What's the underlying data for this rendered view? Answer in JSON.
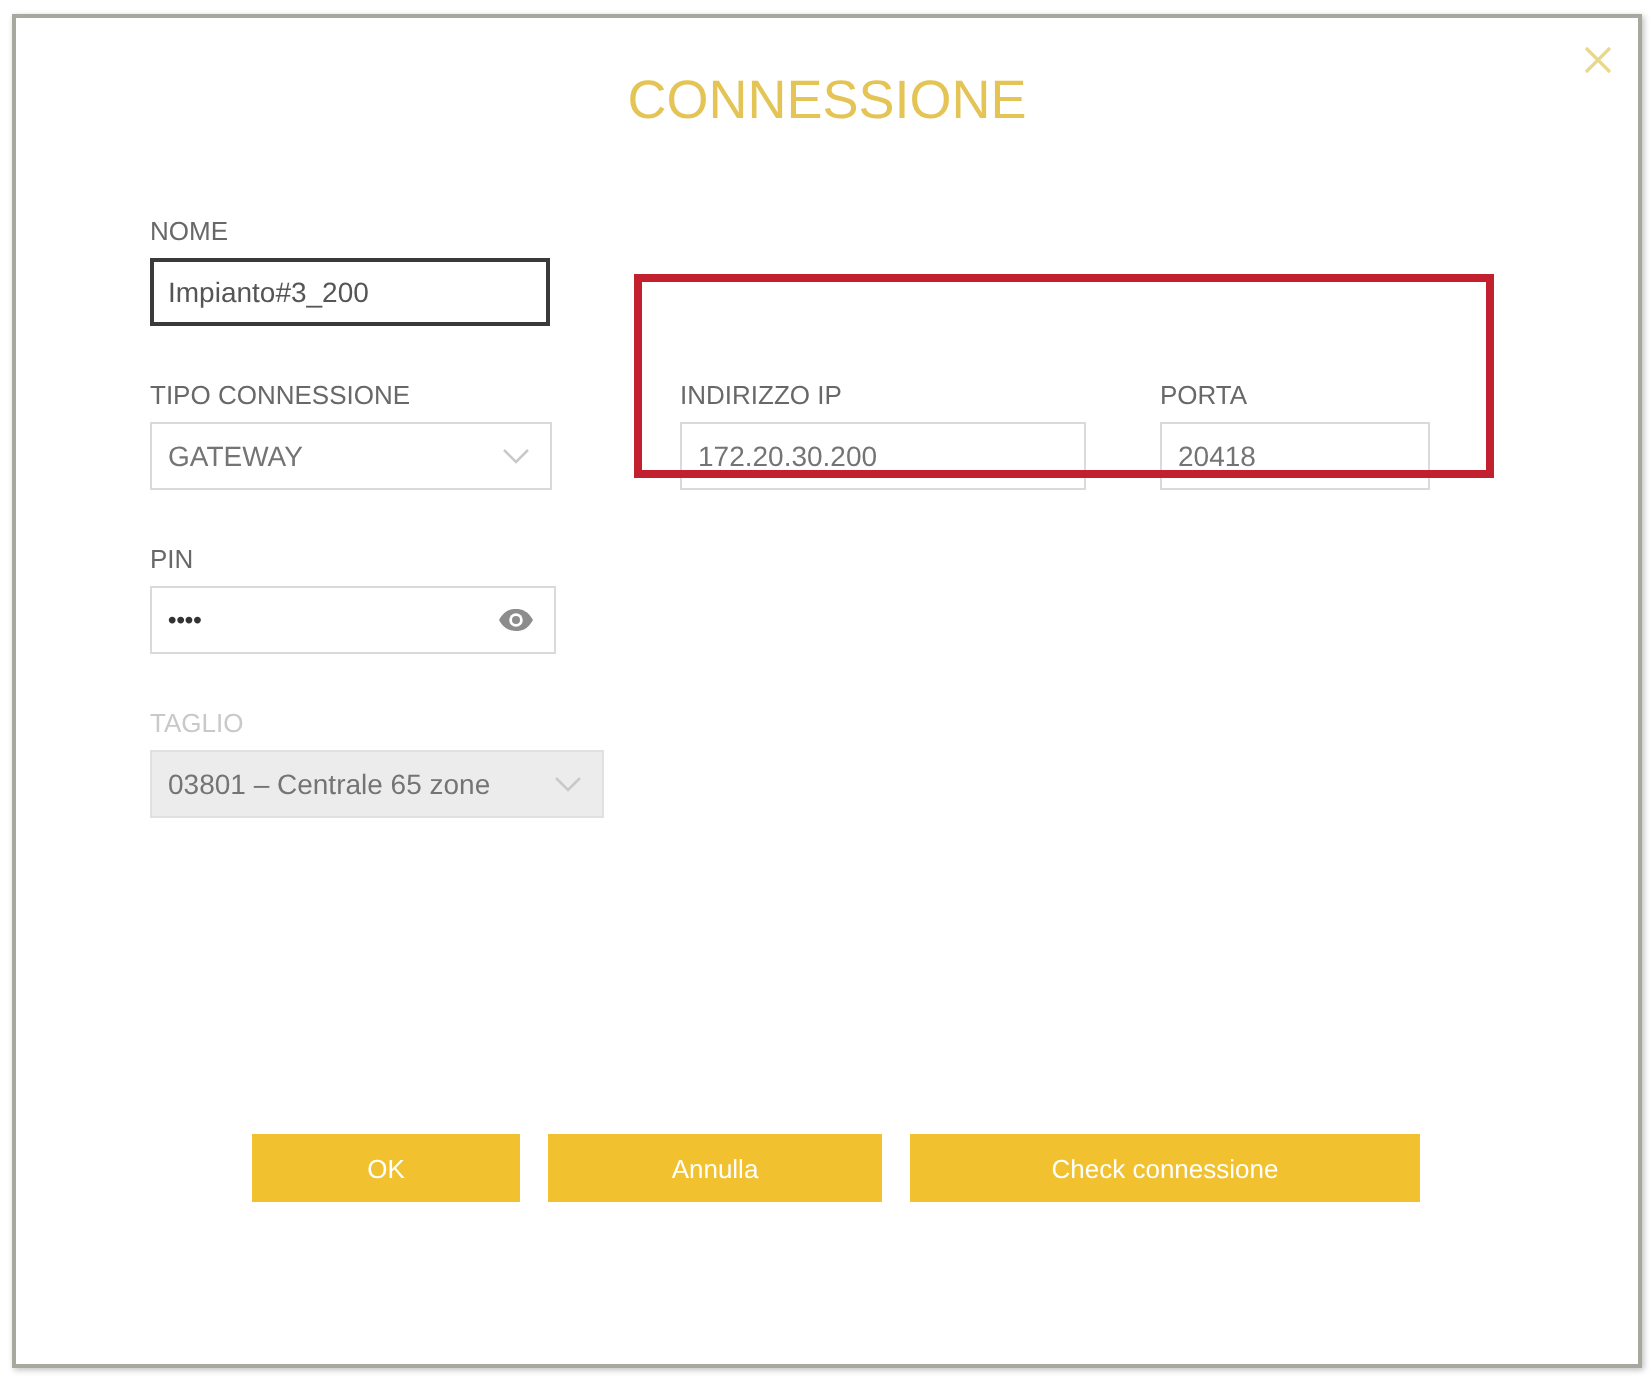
{
  "dialog": {
    "title": "CONNESSIONE"
  },
  "rows": [
    [
      {
        "kind": "text",
        "label": "NOME",
        "value": "Impianto#3_200",
        "focused": true,
        "disabled": false
      }
    ],
    [
      {
        "kind": "select",
        "label": "TIPO CONNESSIONE",
        "value": "GATEWAY",
        "focused": false,
        "disabled": false
      },
      {
        "kind": "text",
        "label": "INDIRIZZO IP",
        "value": "172.20.30.200",
        "focused": false,
        "disabled": false
      },
      {
        "kind": "text",
        "label": "PORTA",
        "value": "20418",
        "focused": false,
        "disabled": false
      }
    ],
    [
      {
        "kind": "password",
        "label": "PIN",
        "value": "••••",
        "focused": false,
        "disabled": false
      }
    ],
    [
      {
        "kind": "select",
        "label": "TAGLIO",
        "value": "03801 – Centrale 65 zone",
        "focused": false,
        "disabled": true
      }
    ]
  ],
  "buttons": [
    {
      "label": "OK"
    },
    {
      "label": "Annulla"
    },
    {
      "label": "Check connessione"
    }
  ]
}
